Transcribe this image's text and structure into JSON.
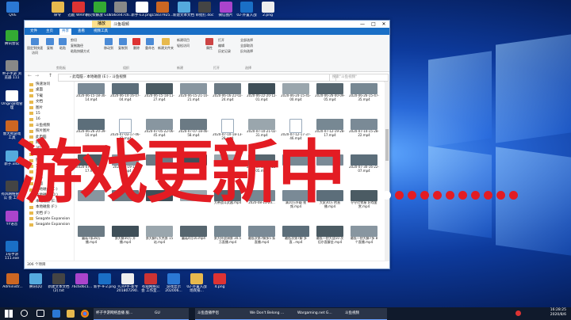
{
  "desktop": {
    "top_icons": [
      "腾讯...",
      "",
      "CE",
      "回收站",
      "",
      "合助",
      "百度",
      "迅雷",
      "极速小说",
      "",
      "",
      "",
      "新建文件夹"
    ],
    "top_labels": [
      "QVE",
      "命令",
      "迅能 WRm解",
      "火柴解放 GUI",
      "2a6ce47c6...",
      "新手-E3.png",
      "15837925...",
      "新建文本文档",
      "审批打.doc",
      "微信图片",
      "02-外置入战",
      "2.png"
    ],
    "left_icons": [
      "腾讯会议",
      "杯子手游 浏览器 111",
      "Origin游戏管理",
      "鲁大师游戏 工具",
      "新子.xlsx",
      "有风网络管理公 会 工作",
      "YY语音",
      "1号手游 111.exe"
    ],
    "bottom_icons": [
      "Administr...",
      "腾讯QQ",
      "新建文本文档 (2).txt",
      "76c6d6c1...",
      "新手-9-2.png",
      "TCRP手-新专 201807290...",
      "有观网络公 会 工作室...",
      "游戏显示 202006...",
      "02-外置入战 场宾排...",
      "4.png"
    ]
  },
  "explorer": {
    "window_title": "斗鱼视频",
    "context_tab": "播放",
    "window_controls": [
      "—",
      "□",
      "✕"
    ],
    "ribbon_tabs": [
      "文件",
      "主页",
      "共享",
      "查看",
      "视频工具"
    ],
    "ribbon": {
      "clipboard": [
        "固定到快速访问",
        "复制",
        "粘贴",
        "剪切",
        "复制路径",
        "粘贴快捷方式"
      ],
      "organize": [
        "移动到",
        "复制到",
        "删除",
        "重命名"
      ],
      "new": [
        "新建文件夹",
        "新建项目",
        "轻松访问"
      ],
      "open": [
        "属性",
        "打开",
        "编辑",
        "历史记录"
      ],
      "select": [
        "全部选择",
        "全部取消",
        "反向选择"
      ],
      "groups": [
        "剪贴板",
        "组织",
        "新建",
        "打开",
        "选择"
      ]
    },
    "address": "› 此电脑 › 本地磁盘 (E:) › 斗鱼视频",
    "search_placeholder": "搜索\"斗鱼视频\"",
    "nav": [
      "快速访问",
      "桌面",
      "下载",
      "文档",
      "图片",
      "15",
      "16",
      "斗鱼视频",
      "照片图片",
      "此电脑",
      "网络",
      "3D 对象",
      "视频",
      "图片",
      "文档",
      "下载",
      "音乐",
      "桌面",
      "本地磁盘 (C:)",
      "本地磁盘 (D:)",
      "本地磁盘 (E:)",
      "本地磁盘 (F:)",
      "文档 (F:)",
      "Seagate Expansion",
      "Seagate Expansion"
    ],
    "files_row1": [
      "2020-06-15-18-30-14.mp4",
      "2020-06-14-16-07-04.mp4",
      "2020-06-15-18-11-27.mp4",
      "2020-06-15-21-10-21.mp4",
      "2020-06-16-22-02-24.mp4",
      "2020-06-22-20-12-01.mp4",
      "2020-06-24-15-45-00.mp4",
      "2020-06-26-00-09-05.mp4",
      "2020-06-26-15-47-35.mp4"
    ],
    "files_row2": [
      "2020-06-26-20-39-10.mp4",
      "2020-07-03-17-46-42.mp4",
      "2020-07-05-22-06-45.mp4",
      "2020-07-07-18-46-58.mp4",
      "2020-07-10-18-13-28.mp4",
      "2020-07-10-21-02-31.mp4",
      "2020-07-12-17-37-46.mp4",
      "2020-07-12-19-28-17.mp4",
      "2020-07-14-15-28-22.mp4"
    ],
    "files_row3": [
      "2020-07-17-15-19-17.mp4",
      "2020-07-19-14-44.mp4",
      "",
      "",
      "",
      "2020-07-23-20-28-05.mp4",
      "",
      "",
      "2020-07-30-16-22-07.mp4"
    ],
    "files_row4": [
      "",
      "",
      "",
      "",
      "大帝战斗武器.mp4",
      "2020-08-11-23...",
      "满10万升级 视频.mp4",
      "大家30万 的直播.mp4",
      "仔仔红警屋 好戏鉴赏.mp4"
    ],
    "files_row5": [
      "蘑菇7条28万 播.mp4",
      "第大解30万 开播.mp4",
      "第大解行大杰第 15站.mp4",
      "蘑菇4月16.mp4",
      "第大杯战洲第 30.5万直播.mp4",
      "最低次第7解多5 条直播.mp4",
      "最低次第7解 多直...mp4",
      "最低一把大战10 次伍尔直解金.mp4",
      "最低一把大解7多 8个直播.mp4"
    ],
    "status": "306 个项目"
  },
  "overlay": {
    "headline": "游戏更新中"
  },
  "taskbar": {
    "apps": [
      "杯子手游网络直播 服...",
      "GU",
      "斗鱼直播伴侣",
      "We Don't Belong ...",
      "Wargaming.net G...",
      "斗鱼视频"
    ],
    "time": "16:28:25",
    "date": "2020/8/6"
  },
  "colors": {
    "overlay_red": "#e31c23",
    "ribbon_blue": "#1a6fc6",
    "taskbar": "#101a2c"
  }
}
